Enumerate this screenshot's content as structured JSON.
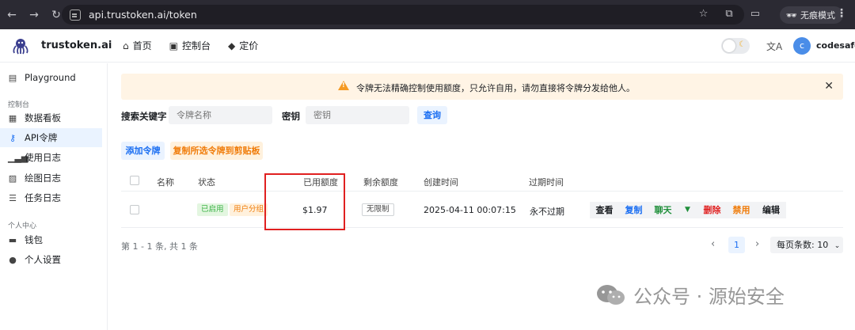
{
  "browser": {
    "url": "api.trustoken.ai/token",
    "incognito_label": "无痕模式"
  },
  "header": {
    "brand": "trustoken.ai",
    "nav": [
      {
        "label": "首页",
        "icon": "home-icon"
      },
      {
        "label": "控制台",
        "icon": "terminal-icon"
      },
      {
        "label": "定价",
        "icon": "tag-icon"
      }
    ],
    "avatar_letter": "c",
    "username": "codesafe"
  },
  "sidebar": {
    "playground": "Playground",
    "group_console": "控制台",
    "items": [
      {
        "label": "数据看板",
        "icon": "dashboard-icon"
      },
      {
        "label": "API令牌",
        "icon": "key-icon",
        "active": true
      },
      {
        "label": "使用日志",
        "icon": "chart-bars-icon"
      },
      {
        "label": "绘图日志",
        "icon": "image-icon"
      },
      {
        "label": "任务日志",
        "icon": "checklist-icon"
      }
    ],
    "group_personal": "个人中心",
    "personal_items": [
      {
        "label": "钱包",
        "icon": "wallet-icon"
      },
      {
        "label": "个人设置",
        "icon": "user-icon"
      }
    ]
  },
  "notice": {
    "text": "令牌无法精确控制使用额度，只允许自用，请勿直接将令牌分发给他人。"
  },
  "search": {
    "keyword_label": "搜索关键字",
    "keyword_placeholder": "令牌名称",
    "key_label": "密钥",
    "key_placeholder": "密钥",
    "query_button": "查询"
  },
  "toolbar": {
    "add_token": "添加令牌",
    "copy_selected": "复制所选令牌到剪贴板"
  },
  "table": {
    "columns": [
      "名称",
      "状态",
      "已用额度",
      "剩余额度",
      "创建时间",
      "过期时间"
    ],
    "rows": [
      {
        "name": "",
        "status": "已启用",
        "group": "用户分组",
        "used_quota": "$1.97",
        "remaining_quota": "无限制",
        "created": "2025-04-11 00:07:15",
        "expires": "永不过期",
        "actions": [
          "查看",
          "复制",
          "聊天",
          "删除",
          "禁用",
          "编辑"
        ]
      }
    ]
  },
  "pagination": {
    "info": "第 1 - 1 条, 共 1 条",
    "current_page": "1",
    "page_size_label": "每页条数: 10"
  },
  "watermark": {
    "text": "公众号 · 源始安全"
  },
  "colors": {
    "primary": "#1a6ef2",
    "warning": "#f59a23",
    "danger": "#e02020",
    "success": "#3bb346"
  }
}
